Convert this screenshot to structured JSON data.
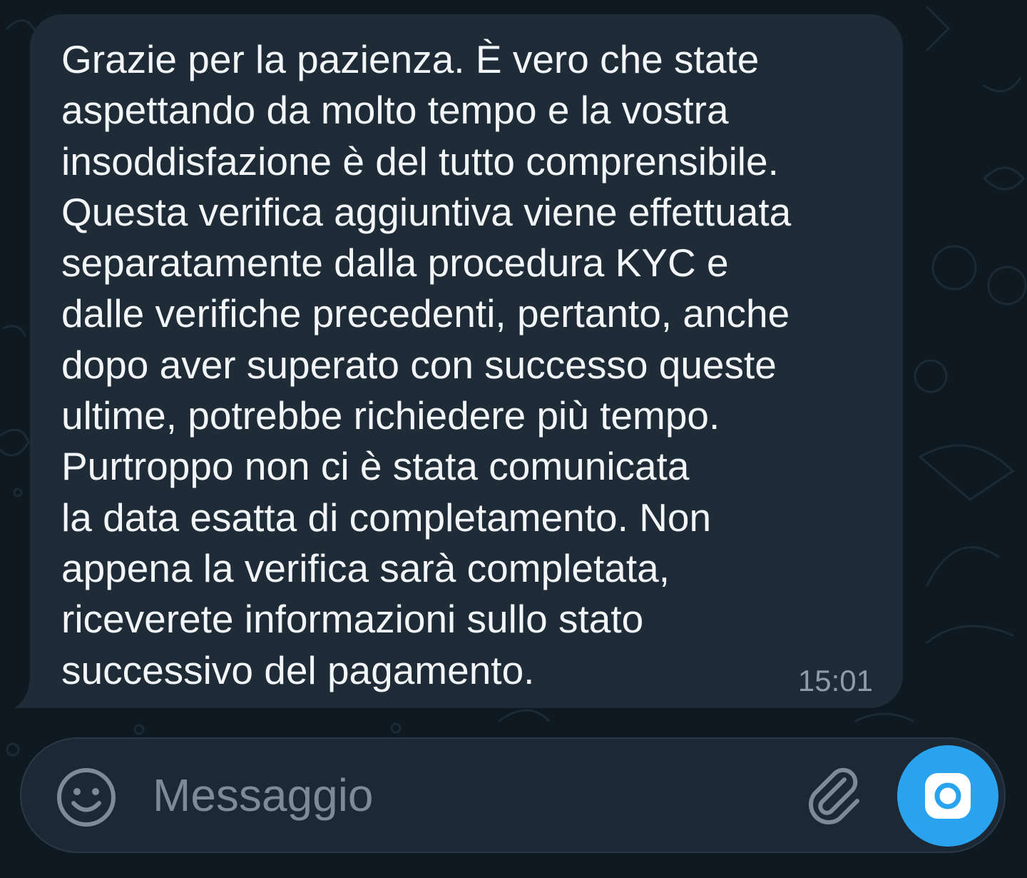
{
  "chat": {
    "message": {
      "text": "Grazie per la pazienza. È vero che state\naspettando da molto tempo e la vostra\ninsoddisfazione è del tutto comprensibile.\nQuesta verifica aggiuntiva viene effettuata\nseparatamente dalla procedura KYC e\ndalle verifiche precedenti, pertanto, anche\ndopo aver superato con successo queste\nultime, potrebbe richiedere più tempo.\nPurtroppo non ci è stata comunicata\nla data esatta di completamento. Non\nappena la verifica sarà completata,\nriceverete informazioni sullo stato\nsuccessivo del pagamento.",
      "time": "15:01"
    }
  },
  "composer": {
    "placeholder": "Messaggio",
    "value": "",
    "emoji_icon": "smiley-icon",
    "attach_icon": "paperclip-icon",
    "camera_icon": "camera-icon"
  },
  "colors": {
    "background": "#0f1922",
    "bubble": "#1f2c38",
    "text": "#f3f6f8",
    "timestamp": "#8f9ba7",
    "accent": "#2aa3ef"
  }
}
